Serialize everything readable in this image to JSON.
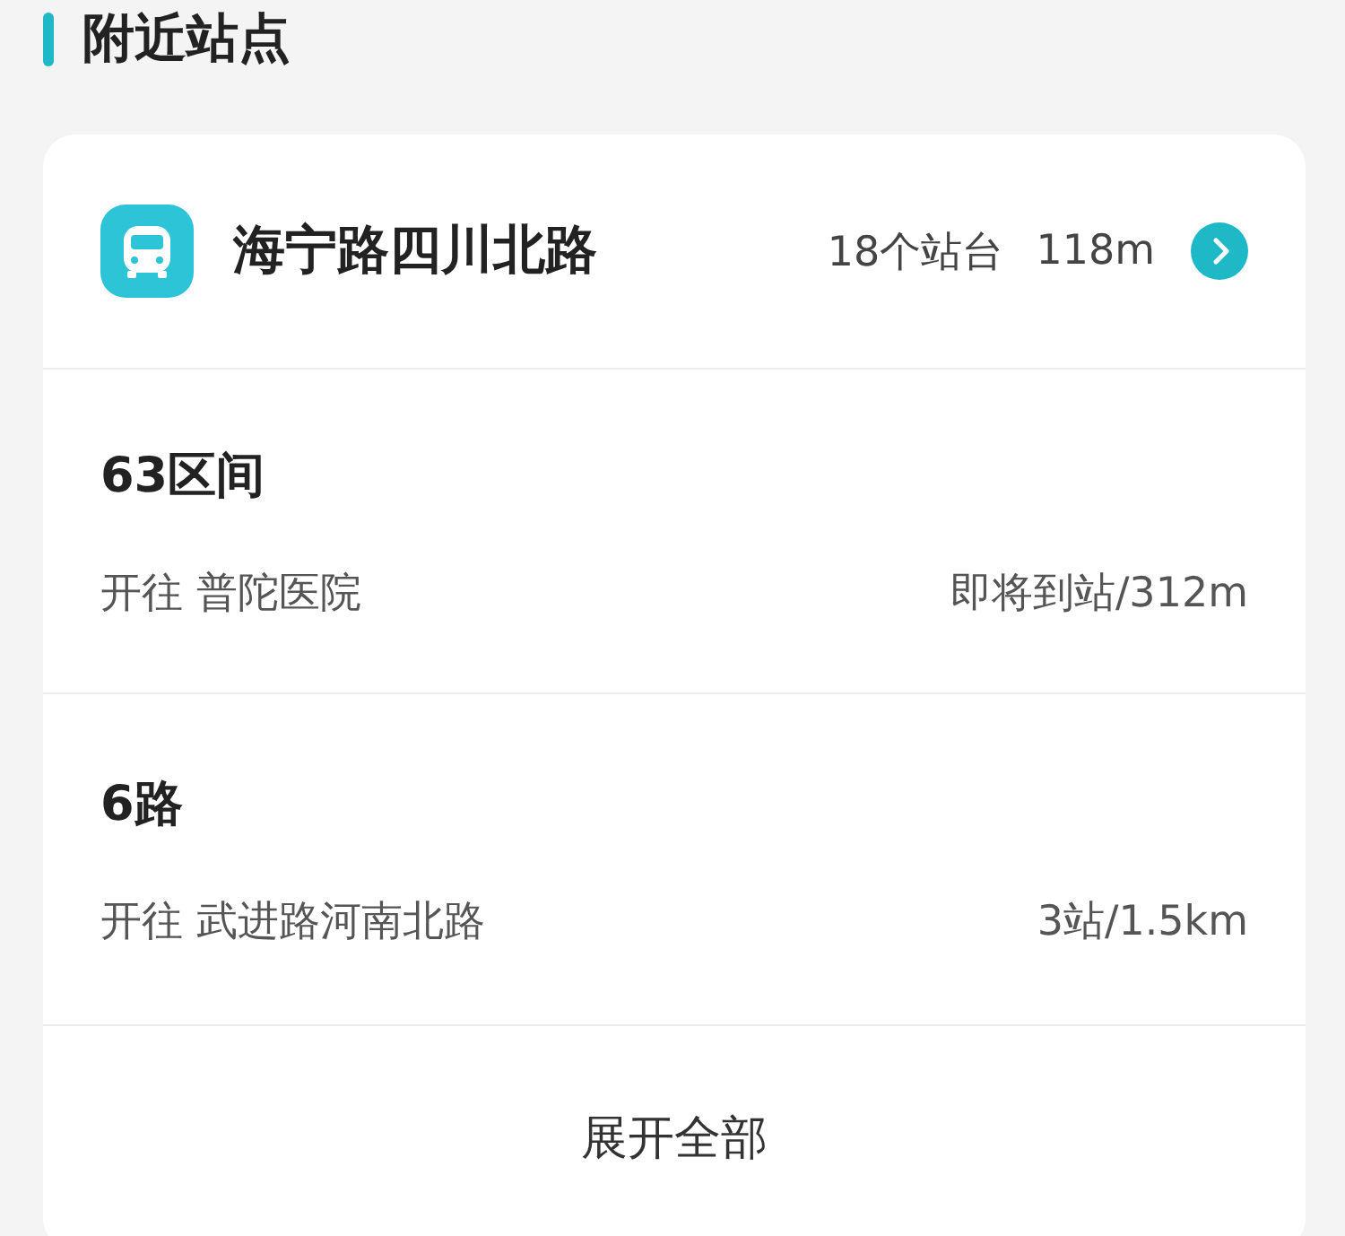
{
  "section_title": "附近站点",
  "station": {
    "name": "海宁路四川北路",
    "platforms": "18个站台",
    "distance": "118m"
  },
  "routes": [
    {
      "name": "63区间",
      "destination": "开往 普陀医院",
      "arrival": "即将到站/312m"
    },
    {
      "name": "6路",
      "destination": "开往 武进路河南北路",
      "arrival": "3站/1.5km"
    }
  ],
  "expand_button": "展开全部"
}
